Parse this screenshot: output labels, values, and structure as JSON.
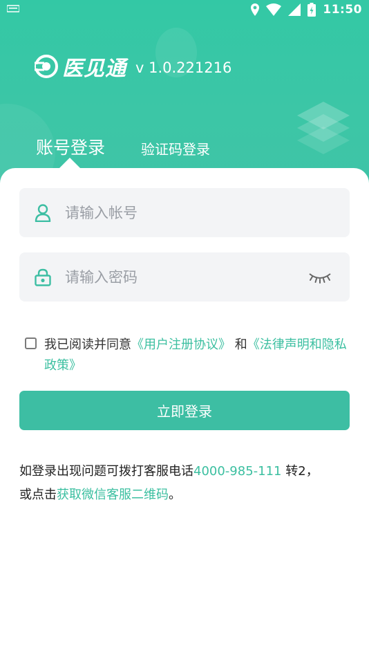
{
  "status_bar": {
    "time": "11:50"
  },
  "app": {
    "logo_text": "医见通",
    "version": "v 1.0.221216"
  },
  "tabs": [
    {
      "label": "账号登录",
      "active": true
    },
    {
      "label": "验证码登录",
      "active": false
    }
  ],
  "form": {
    "account_placeholder": "请输入帐号",
    "password_placeholder": "请输入密码"
  },
  "agreement": {
    "prefix": "我已阅读并同意",
    "user_agreement": "《用户注册协议》",
    "and": " 和",
    "privacy_policy": "《法律声明和隐私政策》"
  },
  "login_button": "立即登录",
  "help": {
    "text1": "如登录出现问题可拨打客服电话",
    "phone": "4000-985-111",
    "text2": " 转2，",
    "text3": "或点击",
    "wechat_link": "获取微信客服二维码",
    "text4": "。"
  },
  "colors": {
    "primary": "#3dbea3",
    "link": "#3bbfa0",
    "field_bg": "#f3f4f6"
  }
}
